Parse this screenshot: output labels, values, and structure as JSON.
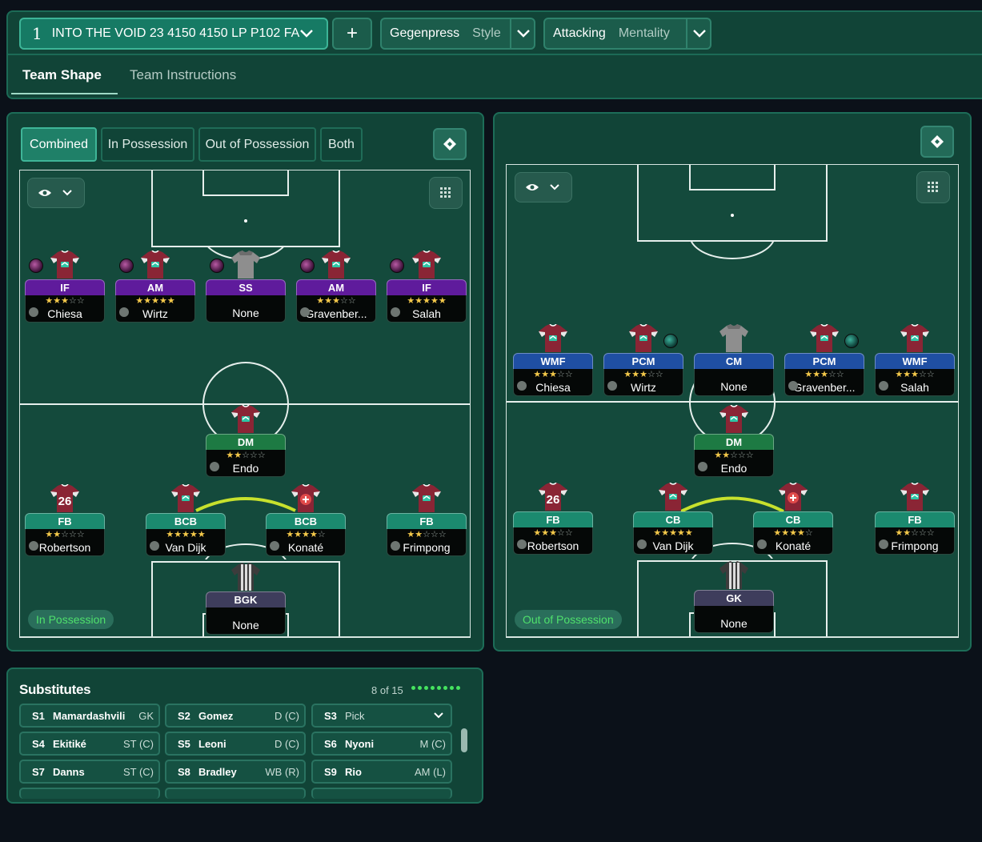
{
  "tactic": {
    "number": "1",
    "name": "INTO THE VOID 23 4150 4150 LP P102 FA"
  },
  "add_label": "+",
  "style": {
    "value": "Gegenpress",
    "label": "Style"
  },
  "mentality": {
    "value": "Attacking",
    "label": "Mentality"
  },
  "tabs": {
    "shape": "Team Shape",
    "instructions": "Team Instructions"
  },
  "view_modes": [
    "Combined",
    "In Possession",
    "Out of Possession",
    "Both"
  ],
  "left_pitch": {
    "label": "In Possession",
    "players": [
      {
        "role": "IF",
        "stars": "★★★☆☆",
        "name": "Chiesa",
        "color": "purple"
      },
      {
        "role": "AM",
        "stars": "★★★★★",
        "name": "Wirtz",
        "color": "purple"
      },
      {
        "role": "SS",
        "stars": "",
        "name": "None",
        "color": "purple"
      },
      {
        "role": "AM",
        "stars": "★★★☆☆",
        "name": "Gravenber...",
        "color": "purple"
      },
      {
        "role": "IF",
        "stars": "★★★★★",
        "name": "Salah",
        "color": "purple"
      },
      {
        "role": "DM",
        "stars": "★★☆☆☆",
        "name": "Endo",
        "color": "green"
      },
      {
        "role": "FB",
        "stars": "★★☆☆☆",
        "name": "Robertson",
        "color": "teal",
        "number": "26"
      },
      {
        "role": "BCB",
        "stars": "★★★★★",
        "name": "Van Dijk",
        "color": "teal"
      },
      {
        "role": "BCB",
        "stars": "★★★★☆",
        "name": "Konaté",
        "color": "teal"
      },
      {
        "role": "FB",
        "stars": "★★☆☆☆",
        "name": "Frimpong",
        "color": "teal"
      },
      {
        "role": "BGK",
        "stars": "",
        "name": "None",
        "color": "grey"
      }
    ]
  },
  "right_pitch": {
    "label": "Out of Possession",
    "players": [
      {
        "role": "WMF",
        "stars": "★★★☆☆",
        "name": "Chiesa",
        "color": "blue"
      },
      {
        "role": "PCM",
        "stars": "★★★☆☆",
        "name": "Wirtz",
        "color": "blue"
      },
      {
        "role": "CM",
        "stars": "",
        "name": "None",
        "color": "blue"
      },
      {
        "role": "PCM",
        "stars": "★★★☆☆",
        "name": "Gravenber...",
        "color": "blue"
      },
      {
        "role": "WMF",
        "stars": "★★★☆☆",
        "name": "Salah",
        "color": "blue"
      },
      {
        "role": "DM",
        "stars": "★★☆☆☆",
        "name": "Endo",
        "color": "green"
      },
      {
        "role": "FB",
        "stars": "★★★☆☆",
        "name": "Robertson",
        "color": "teal",
        "number": "26"
      },
      {
        "role": "CB",
        "stars": "★★★★★",
        "name": "Van Dijk",
        "color": "teal"
      },
      {
        "role": "CB",
        "stars": "★★★★☆",
        "name": "Konaté",
        "color": "teal"
      },
      {
        "role": "FB",
        "stars": "★★☆☆☆",
        "name": "Frimpong",
        "color": "teal"
      },
      {
        "role": "GK",
        "stars": "",
        "name": "None",
        "color": "grey"
      }
    ]
  },
  "substitutes": {
    "title": "Substitutes",
    "count": "8 of 15",
    "rows": [
      {
        "slot": "S1",
        "name": "Mamardashvili",
        "pos": "GK"
      },
      {
        "slot": "S2",
        "name": "Gomez",
        "pos": "D (C)"
      },
      {
        "slot": "S3",
        "name": "Pick",
        "pos": ""
      },
      {
        "slot": "S4",
        "name": "Ekitiké",
        "pos": "ST (C)"
      },
      {
        "slot": "S5",
        "name": "Leoni",
        "pos": "D (C)"
      },
      {
        "slot": "S6",
        "name": "Nyoni",
        "pos": "M (C)"
      },
      {
        "slot": "S7",
        "name": "Danns",
        "pos": "ST (C)"
      },
      {
        "slot": "S8",
        "name": "Bradley",
        "pos": "WB (R)"
      },
      {
        "slot": "S9",
        "name": "Rio",
        "pos": "AM (L)"
      }
    ]
  },
  "colors": {
    "accent": "#1f8068",
    "purple": "#5f1b9c",
    "blue": "#1f4fa3",
    "green": "#1d7a43",
    "teal": "#1b8a6f",
    "grey": "#3e3d5c",
    "link_line": "#c7e12d"
  },
  "icons": [
    "chevron-down-icon",
    "plus-icon",
    "tactics-board-icon",
    "eye-icon",
    "grid-icon",
    "shirt-icon",
    "person-icon"
  ]
}
